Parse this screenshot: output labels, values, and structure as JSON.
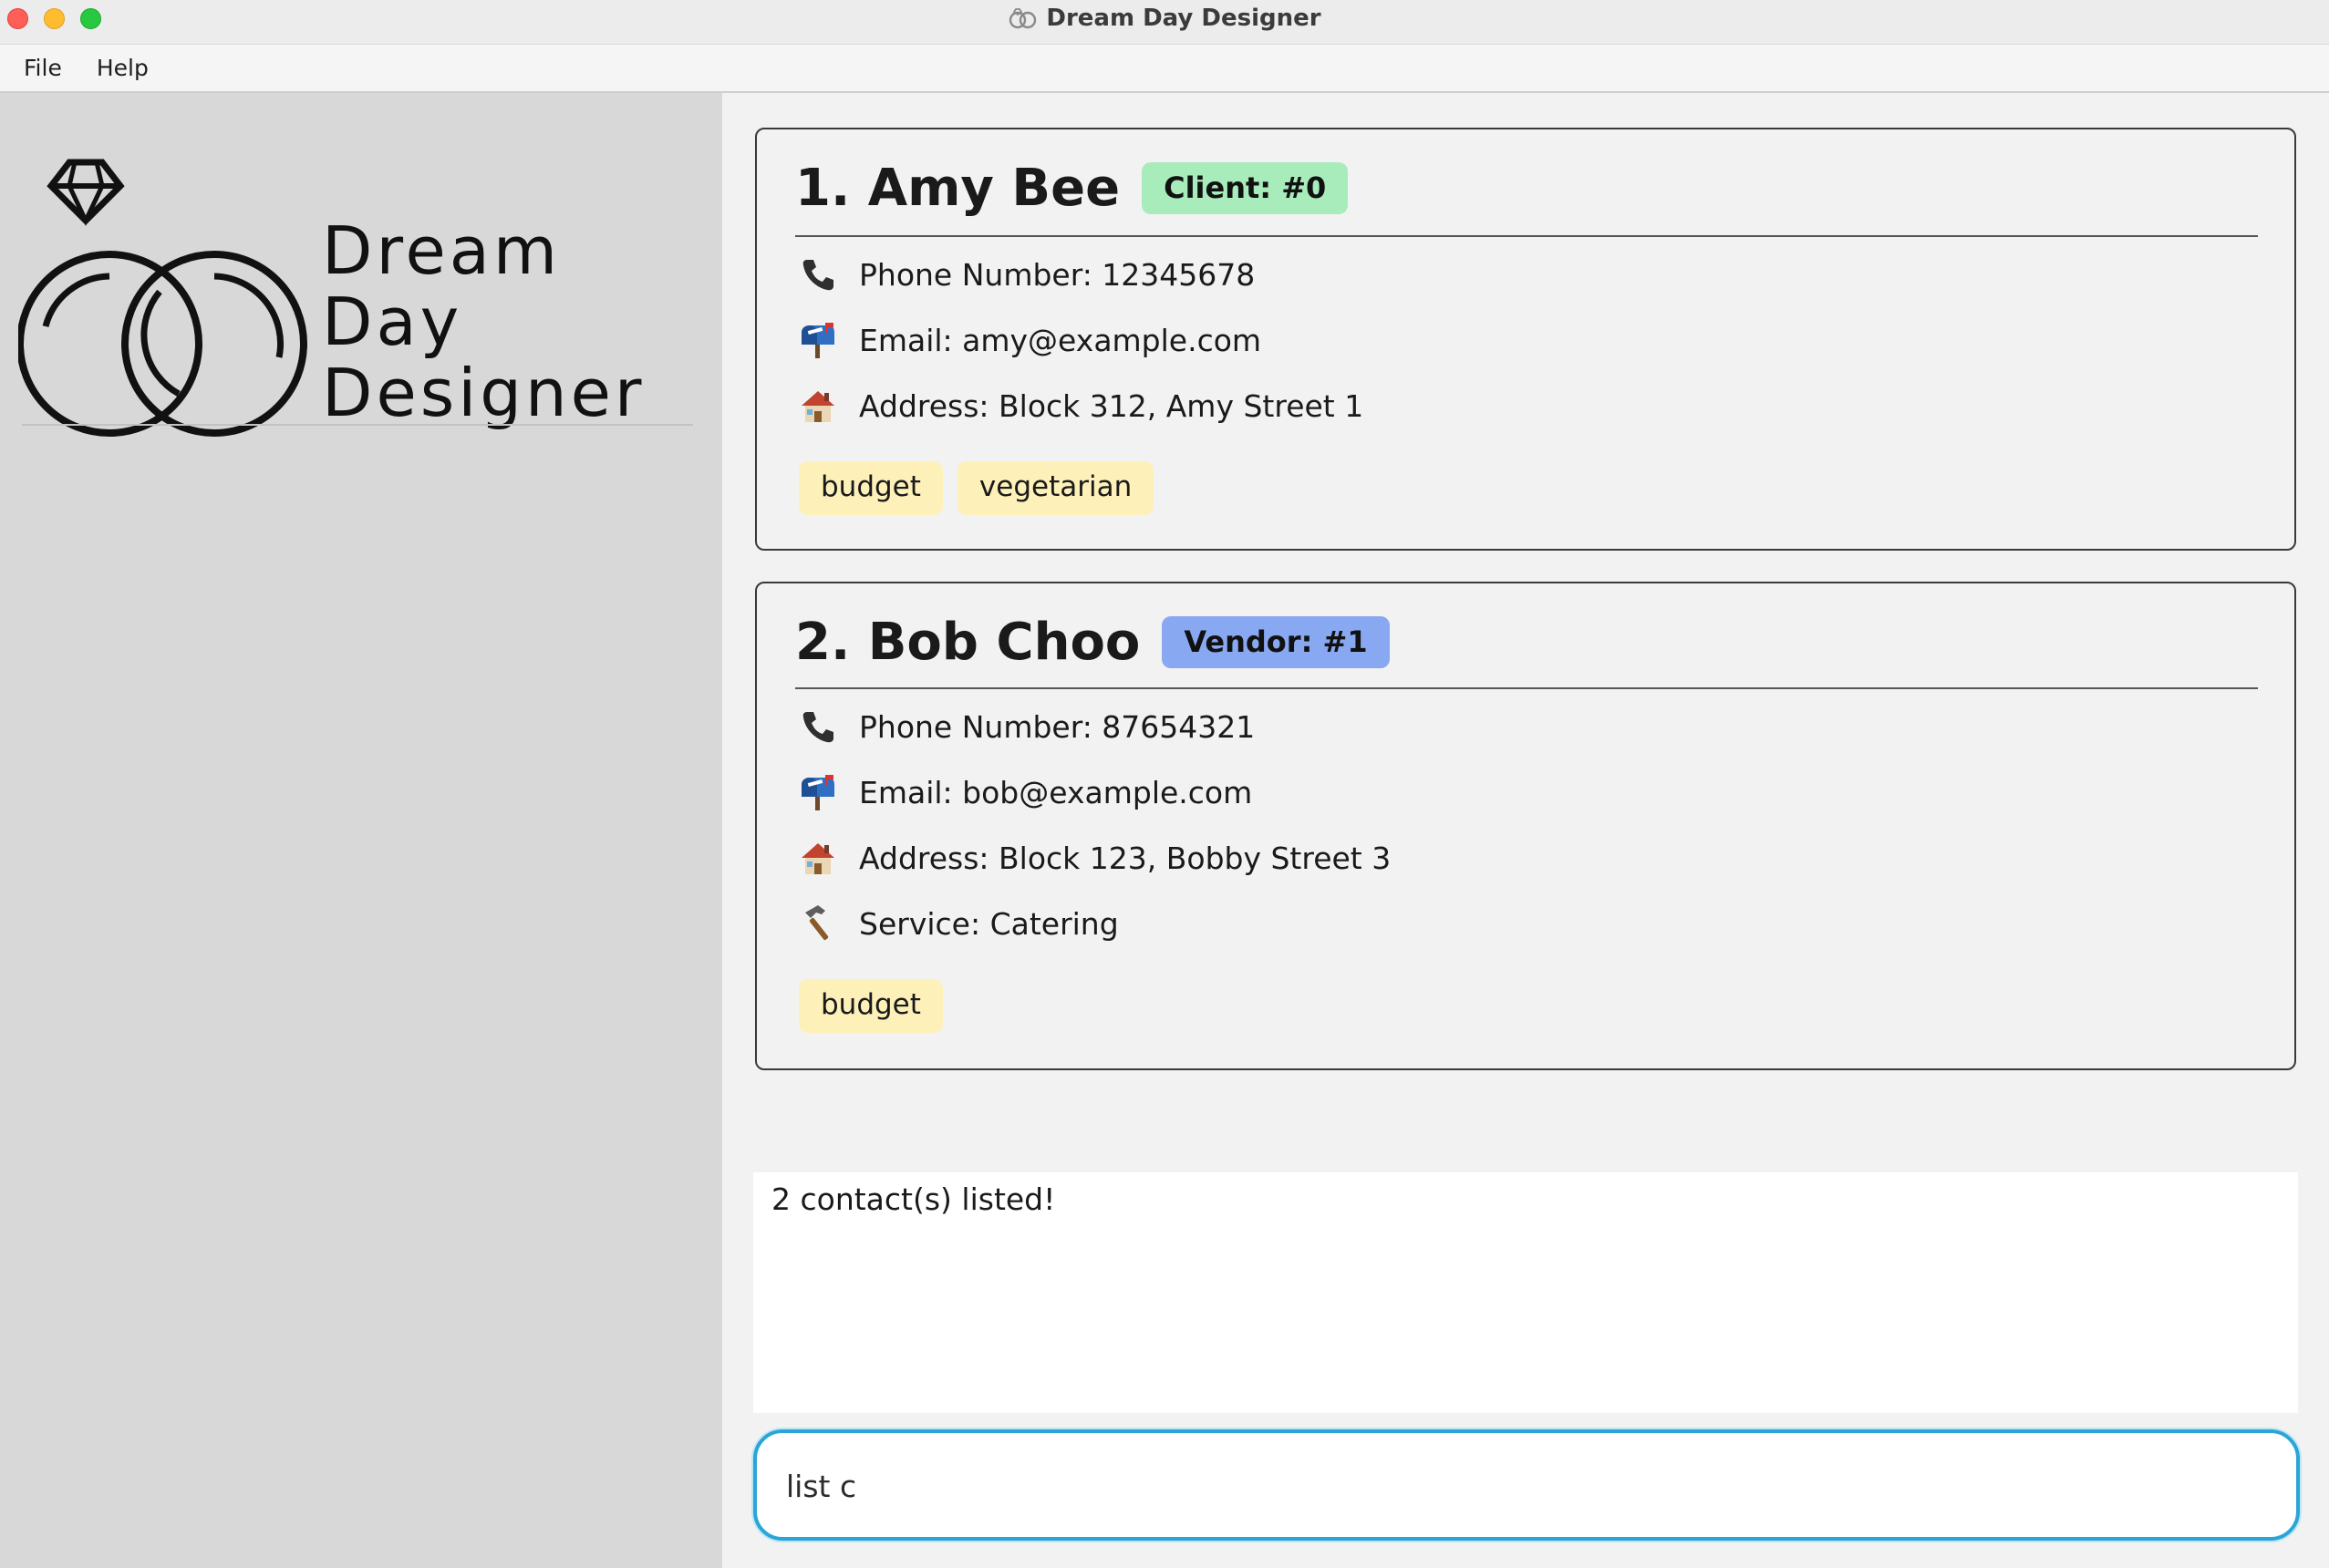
{
  "window": {
    "title": "Dream Day Designer"
  },
  "menu": {
    "items": [
      "File",
      "Help"
    ]
  },
  "logo": {
    "line1": "Dream",
    "line2": "Day",
    "line3": "Designer",
    "icon": "rings-icon"
  },
  "contacts": [
    {
      "name": "1. Amy Bee",
      "badge": "Client: #0",
      "badge_color": "#a8ecbb",
      "phone": "Phone Number: 12345678",
      "email": "Email: amy@example.com",
      "address": "Address: Block 312, Amy Street 1",
      "tags": [
        "budget",
        "vegetarian"
      ]
    },
    {
      "name": "2. Bob Choo",
      "badge": "Vendor: #1",
      "badge_color": "#89a8f2",
      "phone": "Phone Number: 87654321",
      "email": "Email: bob@example.com",
      "address": "Address: Block 123, Bobby Street 3",
      "service": "Service: Catering",
      "tags": [
        "budget"
      ]
    }
  ],
  "result": {
    "text": "2 contact(s) listed!"
  },
  "command": {
    "value": "list c"
  },
  "colors": {
    "tag_background": "#fdf0b8",
    "command_border": "#2aa5d8",
    "sidebar": "#d8d8d8"
  }
}
